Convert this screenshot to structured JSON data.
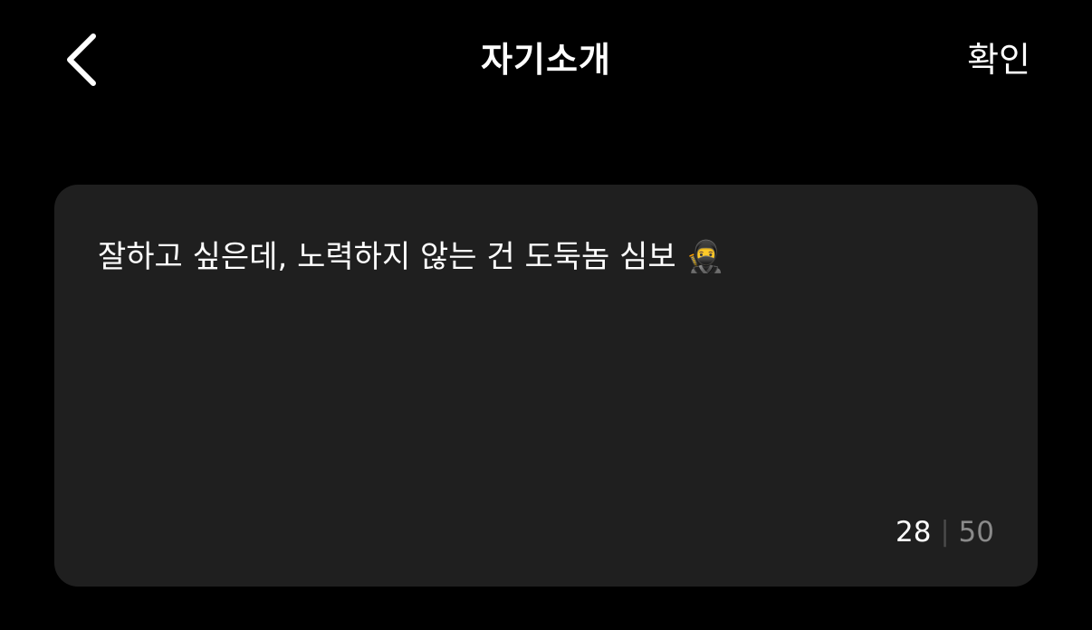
{
  "header": {
    "title": "자기소개",
    "confirm_label": "확인",
    "back_icon": "chevron-left-icon"
  },
  "bio": {
    "text": "잘하고 싶은데, 노력하지 않는 건 도둑놈 심보 🥷",
    "count_current": "28",
    "count_separator": "|",
    "count_max": "50"
  },
  "colors": {
    "background": "#000000",
    "card": "#1f1f1f",
    "text": "#ffffff",
    "muted": "#8a8a8a"
  }
}
